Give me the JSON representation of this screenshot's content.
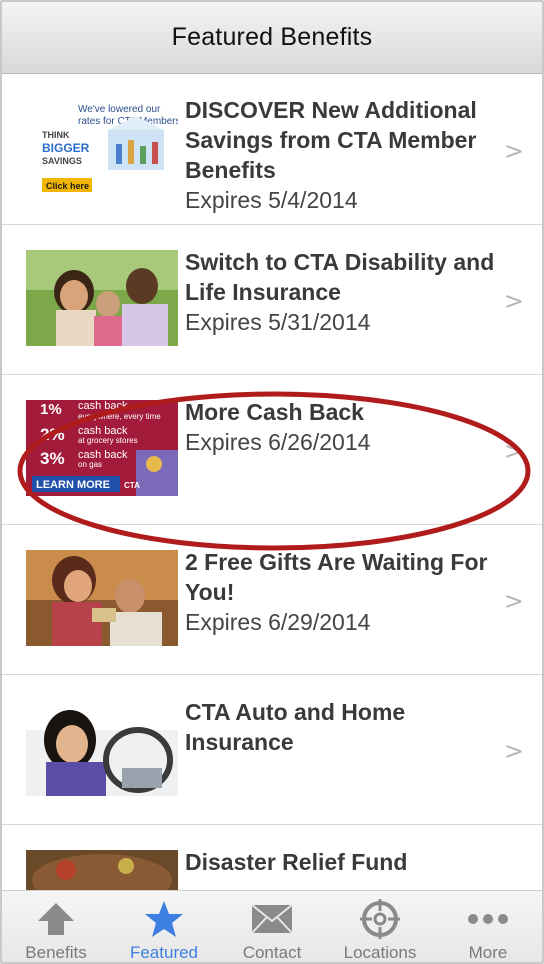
{
  "header": {
    "title": "Featured Benefits"
  },
  "items": [
    {
      "title": "DISCOVER New Additional Savings from CTA Member Benefits",
      "expires": "Expires 5/4/2014",
      "thumb_lines": [
        "We've lowered our",
        "rates for CTA Members!",
        "THINK",
        "BIGGER",
        "SAVINGS",
        "Click here"
      ]
    },
    {
      "title": "Switch to CTA Disability and Life Insurance",
      "expires": "Expires 5/31/2014"
    },
    {
      "title": "More Cash Back",
      "expires": "Expires 6/26/2014",
      "thumb_lines": [
        "1%",
        "cash back",
        "everywhere, every time",
        "2%",
        "cash back",
        "at grocery stores",
        "3%",
        "cash back",
        "on gas",
        "LEARN MORE",
        "CTA"
      ]
    },
    {
      "title": "2 Free Gifts Are Waiting For You!",
      "expires": "Expires 6/29/2014"
    },
    {
      "title": "CTA Auto and Home Insurance",
      "expires": ""
    },
    {
      "title": "Disaster Relief Fund",
      "expires": ""
    }
  ],
  "chevron": ">",
  "tabs": [
    {
      "label": "Benefits",
      "icon": "arrow-up-icon"
    },
    {
      "label": "Featured",
      "icon": "star-icon"
    },
    {
      "label": "Contact",
      "icon": "envelope-icon"
    },
    {
      "label": "Locations",
      "icon": "crosshair-icon"
    },
    {
      "label": "More",
      "icon": "ellipsis-icon"
    }
  ],
  "colors": {
    "accent": "#3d7fe0",
    "highlight_ring": "#b01c1c",
    "tab_inactive": "#7a7a7a"
  }
}
